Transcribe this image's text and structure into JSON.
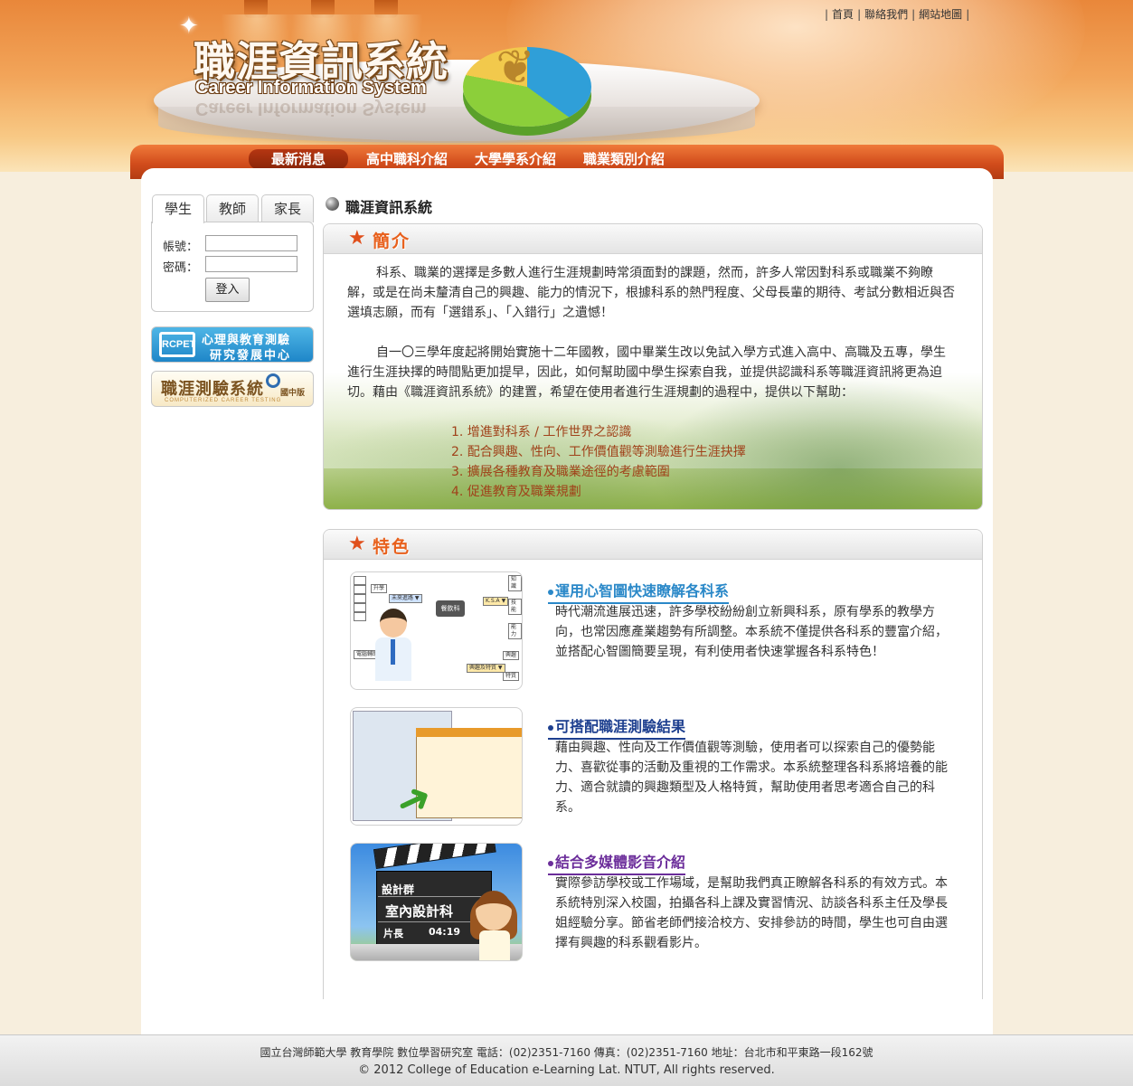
{
  "header": {
    "title": "職涯資訊系統",
    "subtitle": "Career Information System",
    "top_links": [
      "首頁",
      "聯絡我們",
      "網站地圖"
    ]
  },
  "nav": {
    "items": [
      {
        "label": "最新消息",
        "active": true
      },
      {
        "label": "高中職科介紹",
        "active": false
      },
      {
        "label": "大學學系介紹",
        "active": false
      },
      {
        "label": "職業類別介紹",
        "active": false
      }
    ]
  },
  "login": {
    "tabs": [
      "學生",
      "教師",
      "家長"
    ],
    "active_tab": "學生",
    "account_label": "帳號：",
    "account_value": "",
    "password_label": "密碼：",
    "password_value": "",
    "submit_label": "登入"
  },
  "banners": {
    "rcpet": {
      "line1": "心理與教育測驗",
      "line2": "研究發展中心",
      "icon": "RCPET"
    },
    "testing": {
      "line1": "職涯測驗系統",
      "edition": "國中版",
      "line2": "COMPUTERIZED CAREER TESTING"
    }
  },
  "section_title": "職涯資訊系統",
  "intro": {
    "heading": "簡介",
    "p1": "科系、職業的選擇是多數人進行生涯規劃時常須面對的課題，然而，許多人常因對科系或職業不夠瞭解，或是在尚未釐清自己的興趣、能力的情況下，根據科系的熱門程度、父母長輩的期待、考試分數相近與否選填志願，而有「選錯系」、「入錯行」之遺憾！",
    "p2": "自一〇三學年度起將開始實施十二年國教，國中畢業生改以免試入學方式進入高中、高職及五專，學生進行生涯抉擇的時間點更加提早，因此，如何幫助國中學生探索自我，並提供認識科系等職涯資訊將更為迫切。藉由《職涯資訊系統》的建置，希望在使用者進行生涯規劃的過程中，提供以下幫助：",
    "list": [
      "1. 增進對科系 / 工作世界之認識",
      "2. 配合興趣、性向、工作價值觀等測驗進行生涯抉擇",
      "3. 擴展各種教育及職業途徑的考慮範圍",
      "4. 促進教育及職業規劃"
    ]
  },
  "features": {
    "heading": "特色",
    "items": [
      {
        "title": "運用心智圖快速瞭解各科系",
        "color": "#2a88c8",
        "text": "時代潮流進展迅速，許多學校紛紛創立新興科系，原有學系的教學方向，也常因應產業趨勢有所調整。本系統不僅提供各科系的豐富介紹，並搭配心智圖簡要呈現，有利使用者快速掌握各科系特色！"
      },
      {
        "title": "可搭配職涯測驗結果",
        "color": "#1d3f8f",
        "text": "藉由興趣、性向及工作價值觀等測驗，使用者可以探索自己的優勢能力、喜歡從事的活動及重視的工作需求。本系統整理各科系將培養的能力、適合就讀的興趣類型及人格特質，幫助使用者思考適合自己的科系。"
      },
      {
        "title": "結合多媒體影音介紹",
        "color": "#6b2d9a",
        "text": "實際參訪學校或工作場域，是幫助我們真正瞭解各科系的有效方式。本系統特別深入校園，拍攝各科上課及實習情況、訪談各科系主任及學長姐經驗分享。節省老師們接洽校方、安排參訪的時間，學生也可自由選擇有興趣的科系觀看影片。"
      }
    ]
  },
  "illustrations": {
    "mindmap_center": "餐飲科",
    "mindmap_nodes": [
      "升學",
      "K.S.A ▼",
      "知識",
      "技能",
      "能力",
      "電腦輔助",
      "興趣及特質 ▼",
      "興趣",
      "特質",
      "未來進路 ▼"
    ],
    "video": {
      "group": "設計群",
      "subject": "室內設計科",
      "length_label": "片長",
      "length": "04:19"
    }
  },
  "footer": {
    "line1": "國立台灣師範大學 教育學院 數位學習研究室 電話：(02)2351-7160 傳真：(02)2351-7160 地址：台北市和平東路一段162號",
    "line2": "© 2012 College of Education e-Learning Lat. NTUT, All rights reserved."
  }
}
